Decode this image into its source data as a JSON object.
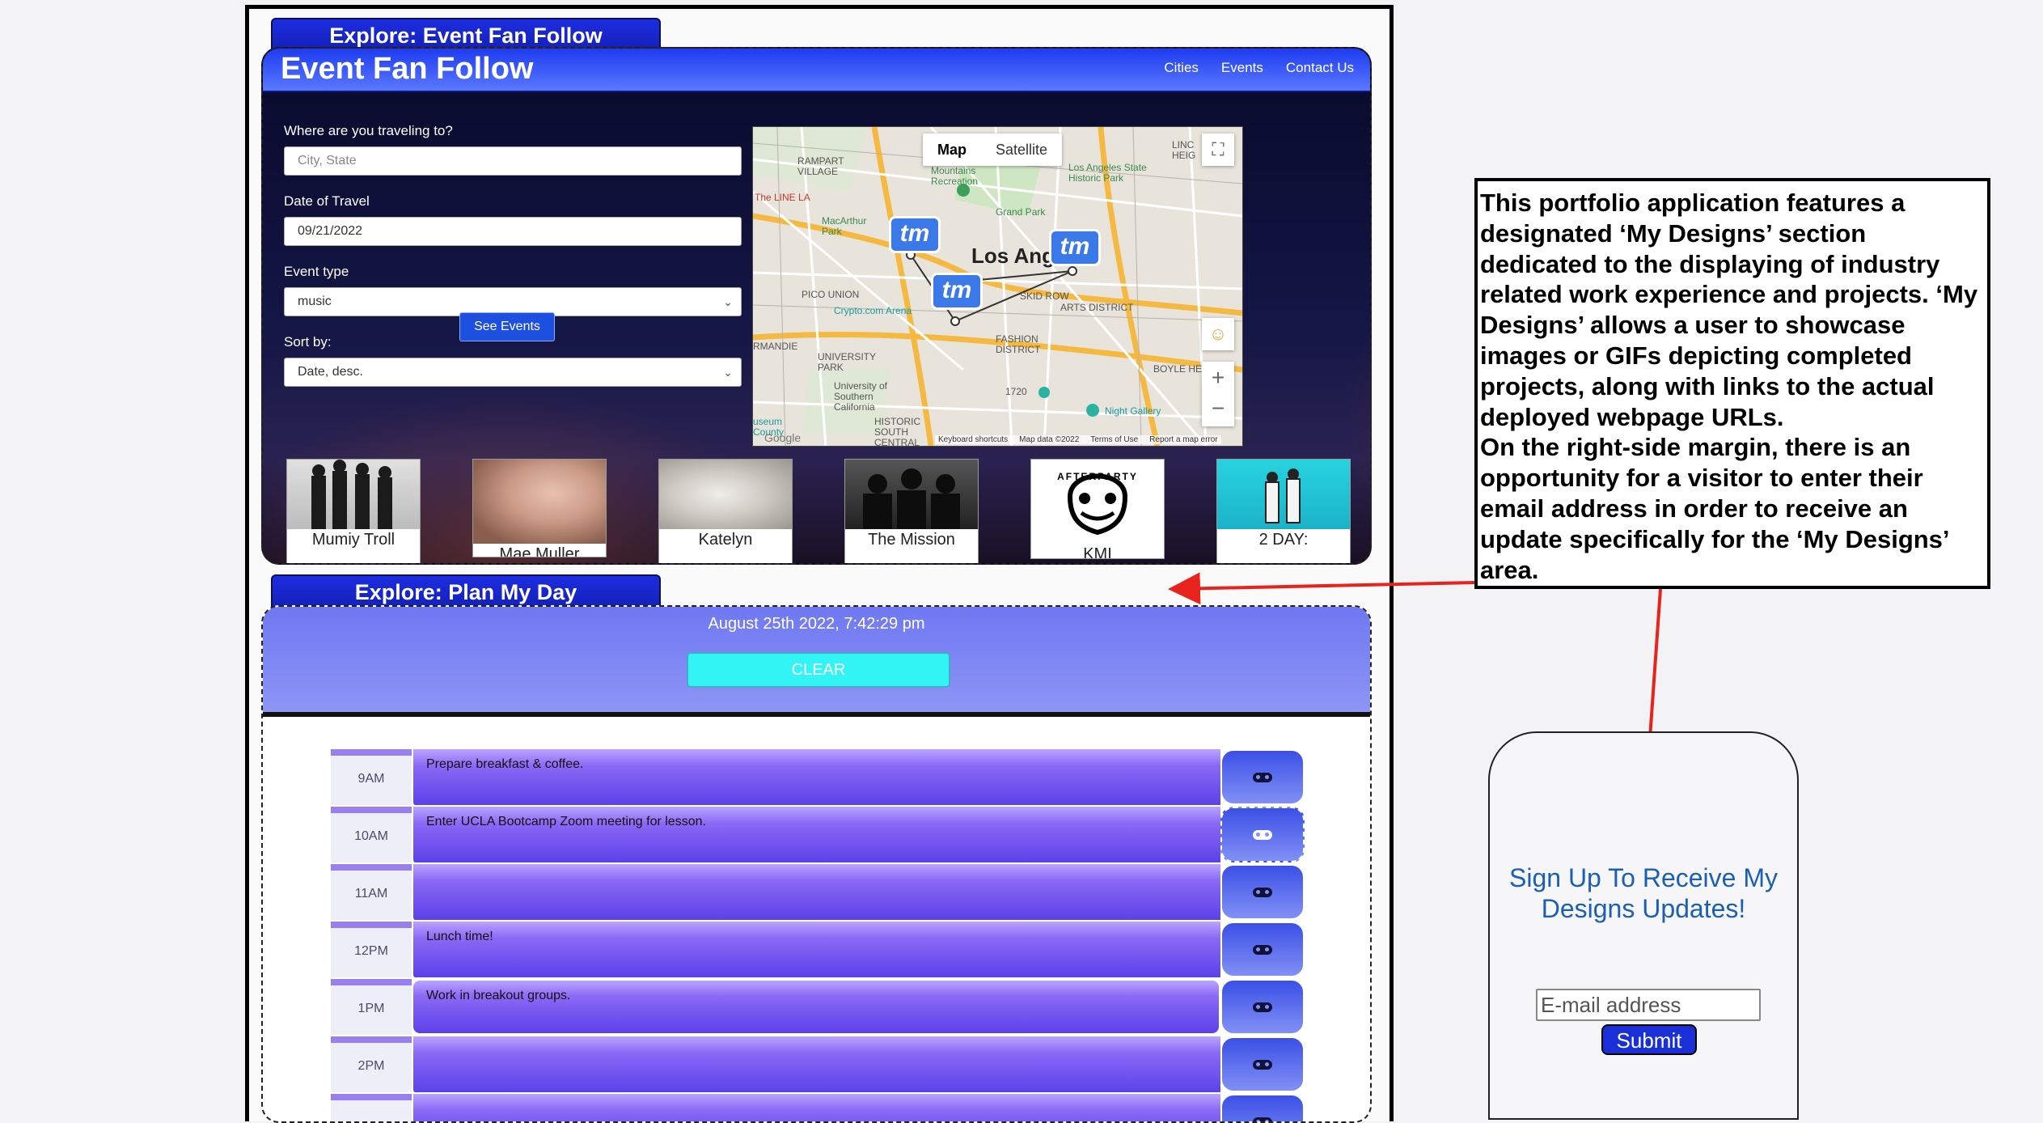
{
  "event_fan_follow": {
    "tab_label": "Explore: Event Fan Follow",
    "brand": "Event Fan Follow",
    "nav_links": [
      "Cities",
      "Events",
      "Contact Us"
    ],
    "form": {
      "travel_label": "Where are you traveling to?",
      "travel_placeholder": "City, State",
      "date_label": "Date of Travel",
      "date_value": "09/21/2022",
      "type_label": "Event type",
      "type_value": "music",
      "sort_label": "Sort by:",
      "sort_value": "Date, desc.",
      "submit_label": "See Events"
    },
    "map": {
      "toggle": [
        "Map",
        "Satellite"
      ],
      "city_label": "Los Angeles",
      "marker_label": "tm",
      "zoom_in": "+",
      "zoom_out": "−",
      "place_labels": [
        "RAMPART VILLAGE",
        "Mountains Recreation",
        "Los Angeles State Historic Park",
        "LINC HEIG",
        "The LINE LA",
        "MacArthur Park",
        "Grand Park",
        "PICO UNION",
        "Crypto.com Arena",
        "SKID ROW",
        "ARTS DISTRICT",
        "RMANDIE",
        "UNIVERSITY PARK",
        "FASHION DISTRICT",
        "BOYLE HEIGHTS",
        "University of Southern California",
        "HISTORIC SOUTH CENTRAL",
        "Night Gallery",
        "useum County",
        "1720",
        "Google"
      ],
      "footer": [
        "Keyboard shortcuts",
        "Map data ©2022",
        "Terms of Use",
        "Report a map error"
      ]
    },
    "posters": [
      "Mumiy Troll",
      "Mae Muller",
      "Katelyn",
      "The Mission",
      "KMI",
      "2 DAY:"
    ],
    "poster_logo_text": "AFTERPARTY"
  },
  "plan_my_day": {
    "tab_label": "Explore: Plan My Day",
    "datetime": "August 25th 2022, 7:42:29 pm",
    "clear_label": "CLEAR",
    "rows": [
      {
        "hour": "9AM",
        "task": "Prepare breakfast & coffee."
      },
      {
        "hour": "10AM",
        "task": "Enter UCLA Bootcamp Zoom meeting for lesson."
      },
      {
        "hour": "11AM",
        "task": ""
      },
      {
        "hour": "12PM",
        "task": "Lunch time!"
      },
      {
        "hour": "1PM",
        "task": "Work in breakout groups."
      },
      {
        "hour": "2PM",
        "task": ""
      },
      {
        "hour": "",
        "task": ""
      }
    ]
  },
  "annotation": {
    "paragraph1": "This portfolio application features a designated ‘My Designs’ section dedicated to the displaying of industry related work experience and projects. ‘My Designs’ allows a user to showcase images or GIFs depicting completed projects, along with links to the actual deployed webpage URLs.",
    "paragraph2": "On the right-side margin, there is an opportunity for a visitor to enter their email address in order to receive an update specifically for the ‘My Designs’ area."
  },
  "signup": {
    "title": "Sign Up To Receive My Designs Updates!",
    "email_placeholder": "E-mail address",
    "submit_label": "Submit"
  },
  "colors": {
    "nav_blue": "#1e3cf0",
    "clear_cyan": "#33f4f4",
    "task_purple": "#7a5af2",
    "arrow_red": "#e8231d",
    "signup_text": "#1a5fb4"
  }
}
